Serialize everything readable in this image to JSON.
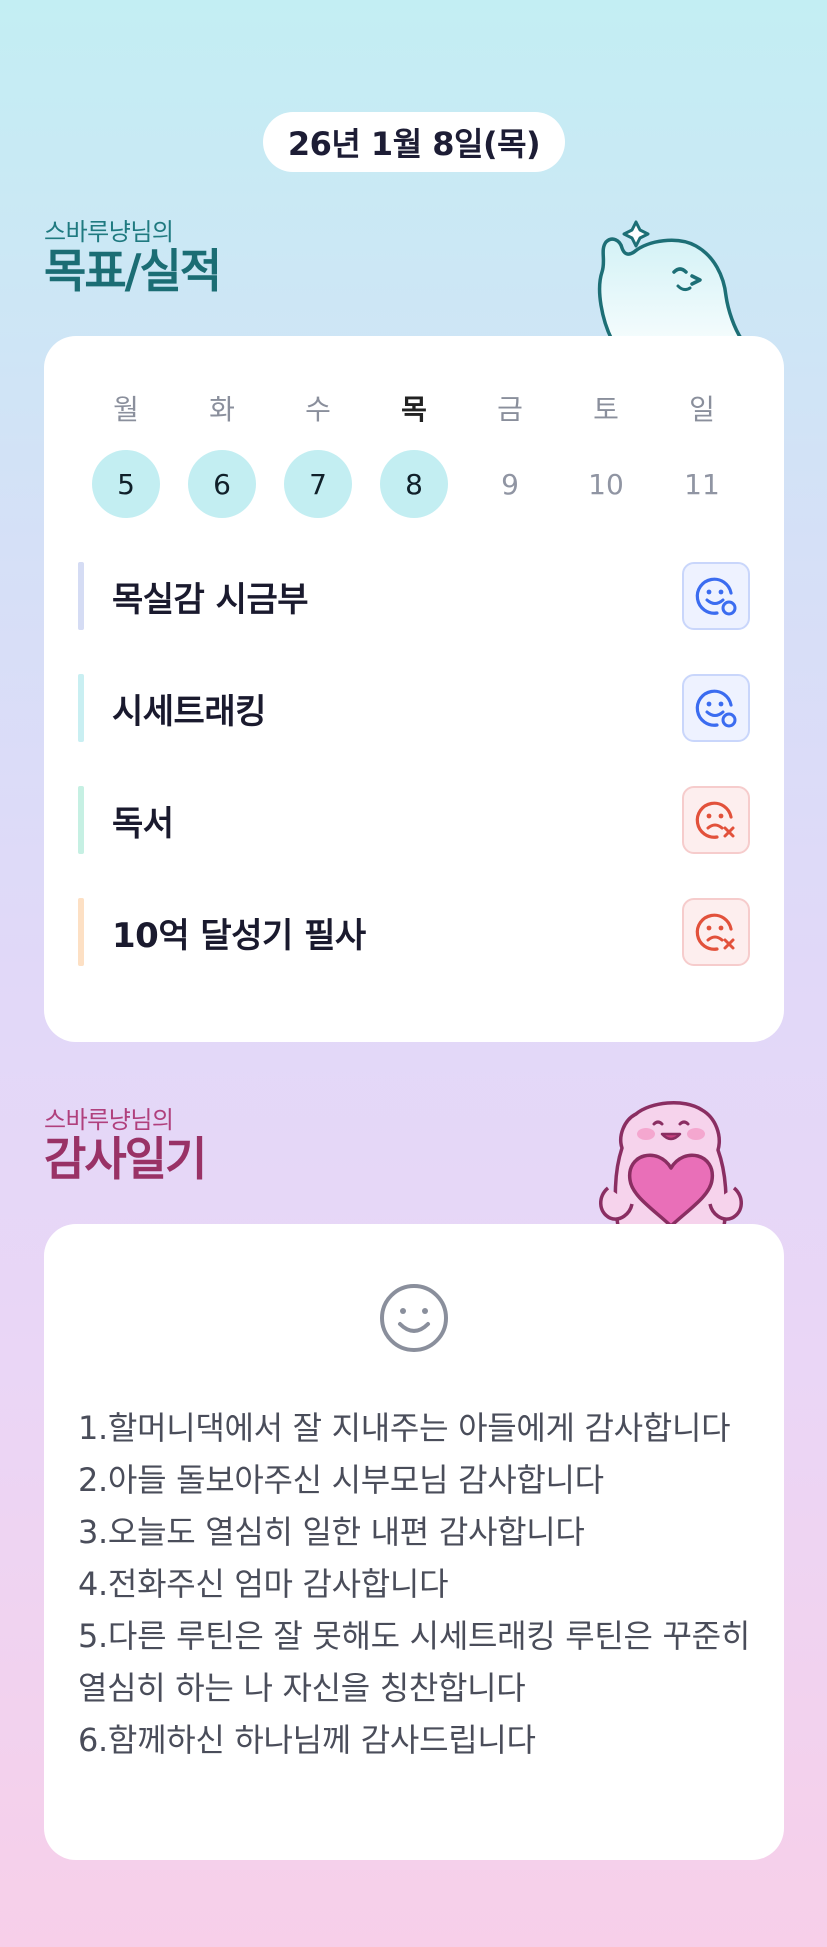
{
  "date": "26년 1월 8일(목)",
  "goals_section": {
    "subtitle": "스바루냥님의",
    "title": "목표/실적"
  },
  "week": [
    {
      "name": "월",
      "num": "5",
      "done": true,
      "today": false
    },
    {
      "name": "화",
      "num": "6",
      "done": true,
      "today": false
    },
    {
      "name": "수",
      "num": "7",
      "done": true,
      "today": false
    },
    {
      "name": "목",
      "num": "8",
      "done": true,
      "today": true
    },
    {
      "name": "금",
      "num": "9",
      "done": false,
      "today": false
    },
    {
      "name": "토",
      "num": "10",
      "done": false,
      "today": false
    },
    {
      "name": "일",
      "num": "11",
      "done": false,
      "today": false
    }
  ],
  "goals": [
    {
      "label": "목실감 시금부",
      "status": "success",
      "accent": "#d5dcf4",
      "status_icon": "happy-face-check-icon"
    },
    {
      "label": "시세트래킹",
      "status": "success",
      "accent": "#c9eff2",
      "status_icon": "happy-face-check-icon"
    },
    {
      "label": "독서",
      "status": "fail",
      "accent": "#c6f0e3",
      "status_icon": "sad-face-x-icon"
    },
    {
      "label": "10억 달성기 필사",
      "status": "fail",
      "accent": "#fde0c4",
      "status_icon": "sad-face-x-icon"
    }
  ],
  "thanks_section": {
    "subtitle": "스바루냥님의",
    "title": "감사일기",
    "icon": "smiley-face-icon",
    "lines": [
      "1.할머니댁에서 잘 지내주는 아들에게 감사합니다",
      "2.아들 돌보아주신 시부모님 감사합니다",
      "3.오늘도 열심히 일한 내편 감사합니다",
      "4.전화주신 엄마 감사합니다",
      "5.다른 루틴은 잘 못해도 시세트래킹 루틴은 꾸준히 열심히 하는 나 자신을 칭찬합니다",
      "6.함께하신 하나님께 감사드립니다"
    ]
  },
  "colors": {
    "done_day_bg": "#c3eef2",
    "success_icon": "#3b6cf0",
    "fail_icon": "#e2513b",
    "goals_title": "#1b6d74",
    "thanks_title": "#993266"
  }
}
